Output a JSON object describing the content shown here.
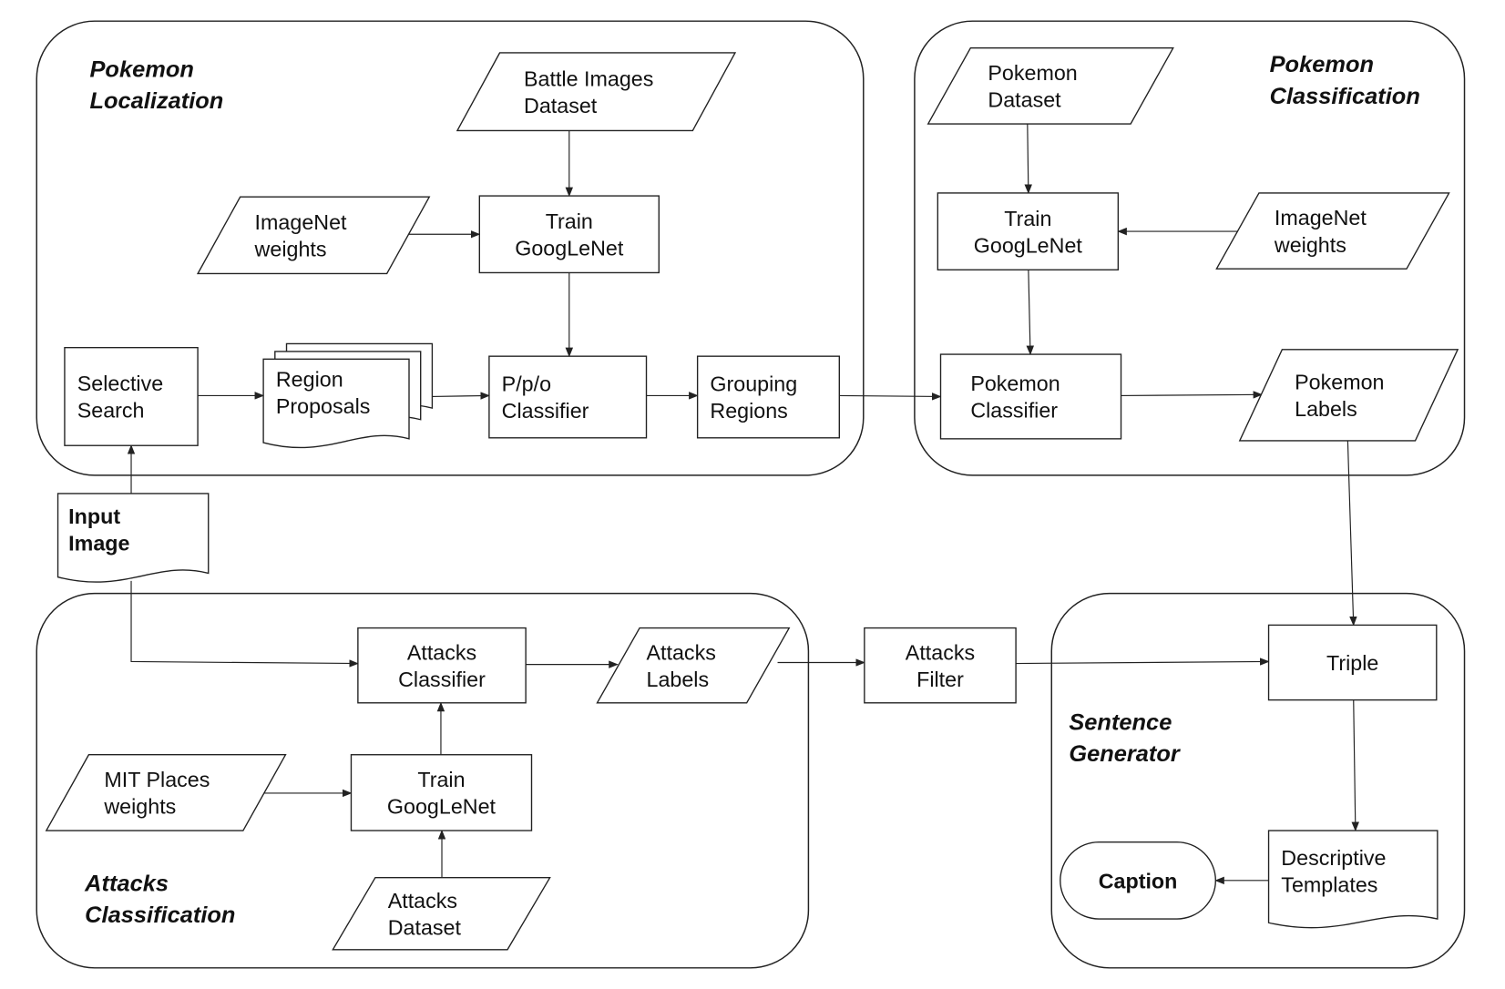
{
  "groups": {
    "pokemon_localization": [
      "Pokemon",
      "Localization"
    ],
    "pokemon_classification": [
      "Pokemon",
      "Classification"
    ],
    "attacks_classification": [
      "Attacks",
      "Classification"
    ],
    "sentence_generator": [
      "Sentence",
      "Generator"
    ]
  },
  "nodes": {
    "battle_images_dataset": [
      "Battle Images",
      "Dataset"
    ],
    "imagenet_weights_loc": [
      "ImageNet",
      "weights"
    ],
    "train_googlenet_loc": [
      "Train",
      "GoogLeNet"
    ],
    "selective_search": [
      "Selective",
      "Search"
    ],
    "region_proposals": [
      "Region",
      "Proposals"
    ],
    "ppo_classifier": [
      "P/p/o",
      "Classifier"
    ],
    "grouping_regions": [
      "Grouping",
      "Regions"
    ],
    "pokemon_dataset": [
      "Pokemon",
      "Dataset"
    ],
    "train_googlenet_cls": [
      "Train",
      "GoogLeNet"
    ],
    "imagenet_weights_cls": [
      "ImageNet",
      "weights"
    ],
    "pokemon_classifier": [
      "Pokemon",
      "Classifier"
    ],
    "pokemon_labels": [
      "Pokemon",
      "Labels"
    ],
    "input_image": [
      "Input",
      "Image"
    ],
    "attacks_classifier": [
      "Attacks",
      "Classifier"
    ],
    "attacks_labels": [
      "Attacks",
      "Labels"
    ],
    "attacks_filter": [
      "Attacks",
      "Filter"
    ],
    "triple": [
      "Triple"
    ],
    "mit_places_weights": [
      "MIT Places",
      "weights"
    ],
    "train_googlenet_att": [
      "Train",
      "GoogLeNet"
    ],
    "attacks_dataset": [
      "Attacks",
      "Dataset"
    ],
    "descriptive_templates": [
      "Descriptive",
      "Templates"
    ],
    "caption": [
      "Caption"
    ]
  }
}
